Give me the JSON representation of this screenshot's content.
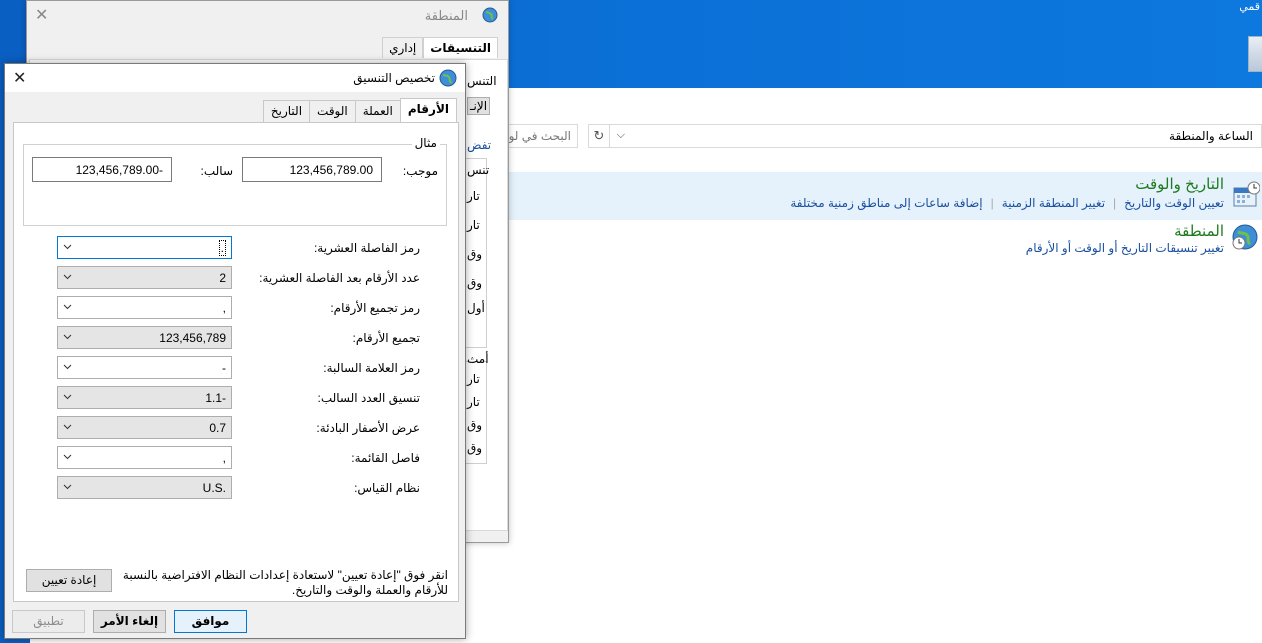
{
  "desktop": {
    "label": "قمي"
  },
  "control_panel": {
    "address": "الساعة والمنطقة",
    "search_placeholder": "البحث في لو",
    "categories": [
      {
        "title": "التاريخ والوقت",
        "links": [
          "تعيين الوقت والتاريخ",
          "تغيير المنطقة الزمنية",
          "إضافة ساعات إلى مناطق زمنية مختلفة"
        ]
      },
      {
        "title": "المنطقة",
        "links": [
          "تغيير تنسيقات التاريخ أو الوقت أو الأرقام"
        ]
      }
    ]
  },
  "region_dialog": {
    "title": "المنطقة",
    "tabs": [
      "التنسيقات",
      "إداري"
    ],
    "fragments": [
      "التنس",
      "الإنـ",
      "تفض",
      "تنس",
      "تار",
      "تار",
      "وق",
      "وق",
      "أول",
      "أمث",
      "تار",
      "تار",
      "وق",
      "وق"
    ]
  },
  "custom_dialog": {
    "title": "تخصيص التنسيق",
    "tabs": [
      "الأرقام",
      "العملة",
      "الوقت",
      "التاريخ"
    ],
    "sample": {
      "legend": "مثال",
      "positive_label": "موجب:",
      "positive_value": "123,456,789.00",
      "negative_label": "سالب:",
      "negative_value": "123,456,789.00-"
    },
    "rows": [
      {
        "label": "رمز الفاصلة العشرية:",
        "value": ".",
        "editable": true
      },
      {
        "label": "عدد الأرقام بعد الفاصلة العشرية:",
        "value": "2",
        "editable": false
      },
      {
        "label": "رمز تجميع الأرقام:",
        "value": ",",
        "editable": true
      },
      {
        "label": "تجميع الأرقام:",
        "value": "123,456,789",
        "editable": false
      },
      {
        "label": "رمز العلامة السالبة:",
        "value": "-",
        "editable": true
      },
      {
        "label": "تنسيق العدد السالب:",
        "value": "1.1-",
        "editable": false
      },
      {
        "label": "عرض الأصفار البادئة:",
        "value": "0.7",
        "editable": false
      },
      {
        "label": "فاصل القائمة:",
        "value": ",",
        "editable": true
      },
      {
        "label": "نظام القياس:",
        "value": "U.S.",
        "editable": false
      }
    ],
    "reset_text": "انقر فوق \"إعادة تعيين\" لاستعادة إعدادات النظام الافتراضية بالنسبة للأرقام والعملة والوقت والتاريخ.",
    "reset_button": "إعادة تعيين",
    "ok_button": "موافق",
    "cancel_button": "إلغاء الأمر",
    "apply_button": "تطبيق"
  }
}
